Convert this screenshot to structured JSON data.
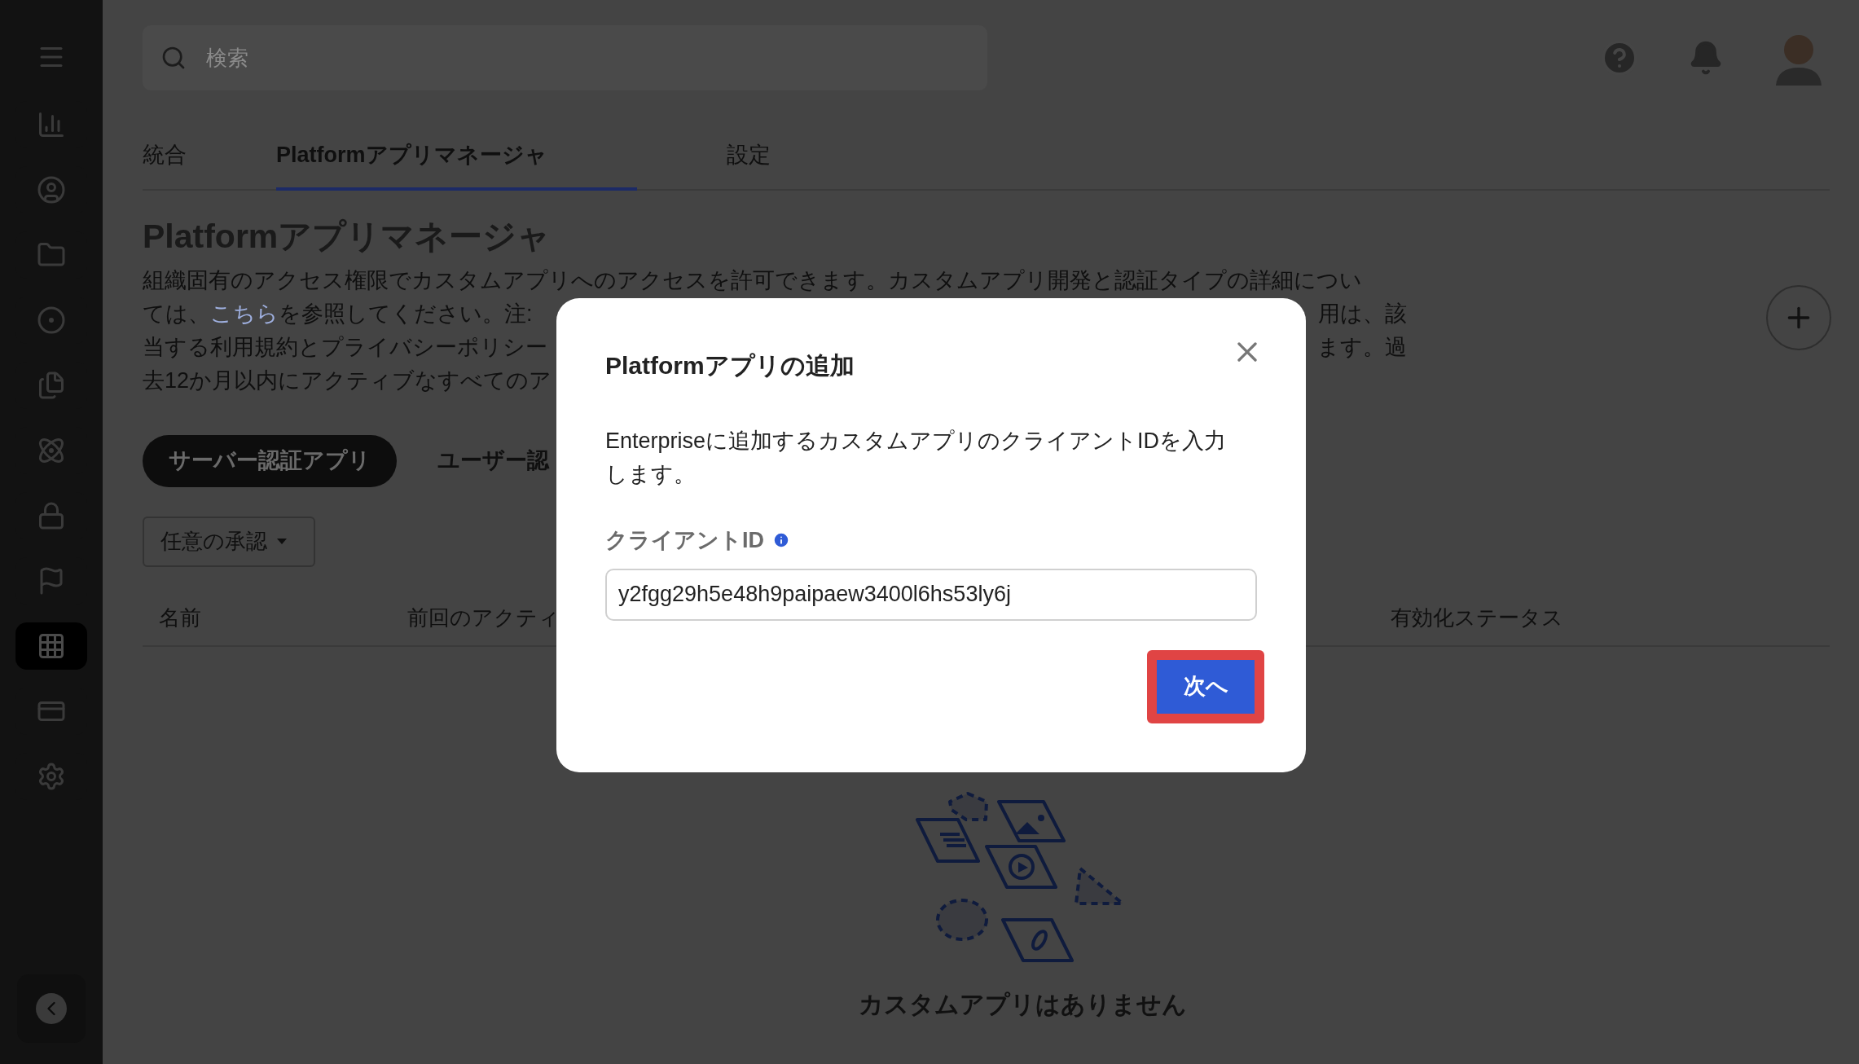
{
  "sidebar": {
    "items": [
      {
        "selected": false
      },
      {
        "selected": false
      },
      {
        "selected": false
      },
      {
        "selected": false
      },
      {
        "selected": false
      },
      {
        "selected": false
      },
      {
        "selected": false
      },
      {
        "selected": false
      },
      {
        "selected": true
      },
      {
        "selected": false
      },
      {
        "selected": false
      }
    ]
  },
  "search": {
    "placeholder": "検索"
  },
  "tabs": [
    {
      "label": "統合",
      "selected": false
    },
    {
      "label": "Platformアプリマネージャ",
      "selected": true
    },
    {
      "label": "設定",
      "selected": false
    }
  ],
  "page_title": "Platformアプリマネージャ",
  "description_lines": [
    {
      "left": "組織固有のアクセス権限でカスタムアプリへのアクセスを許可できます。カスタムアプリ開発と認証タイプの詳細につい"
    },
    {
      "left_before": "ては、",
      "link": "こちら",
      "left": "を参照してください。注:",
      "right": "用は、該"
    },
    {
      "left": "当する利用規約とプライバシーポリシー",
      "right": "ます。過"
    },
    {
      "left": "去12か月以内にアクティブなすべてのア"
    }
  ],
  "app_type_tabs": [
    {
      "label": "サーバー認証アプリ",
      "selected": true
    },
    {
      "label": "ユーザー認",
      "selected": false
    }
  ],
  "filter": {
    "value": "任意の承認"
  },
  "table": {
    "columns": [
      "名前",
      "前回のアクティ",
      "有効化ステータス"
    ]
  },
  "empty_state": {
    "text": "カスタムアプリはありません"
  },
  "dialog": {
    "title": "Platformアプリの追加",
    "description": "Enterpriseに追加するカスタムアプリのクライアントIDを入力します。",
    "field_label": "クライアントID",
    "field_value": "y2fgg29h5e48h9paipaew3400l6hs53ly6j",
    "next_button": "次へ"
  }
}
